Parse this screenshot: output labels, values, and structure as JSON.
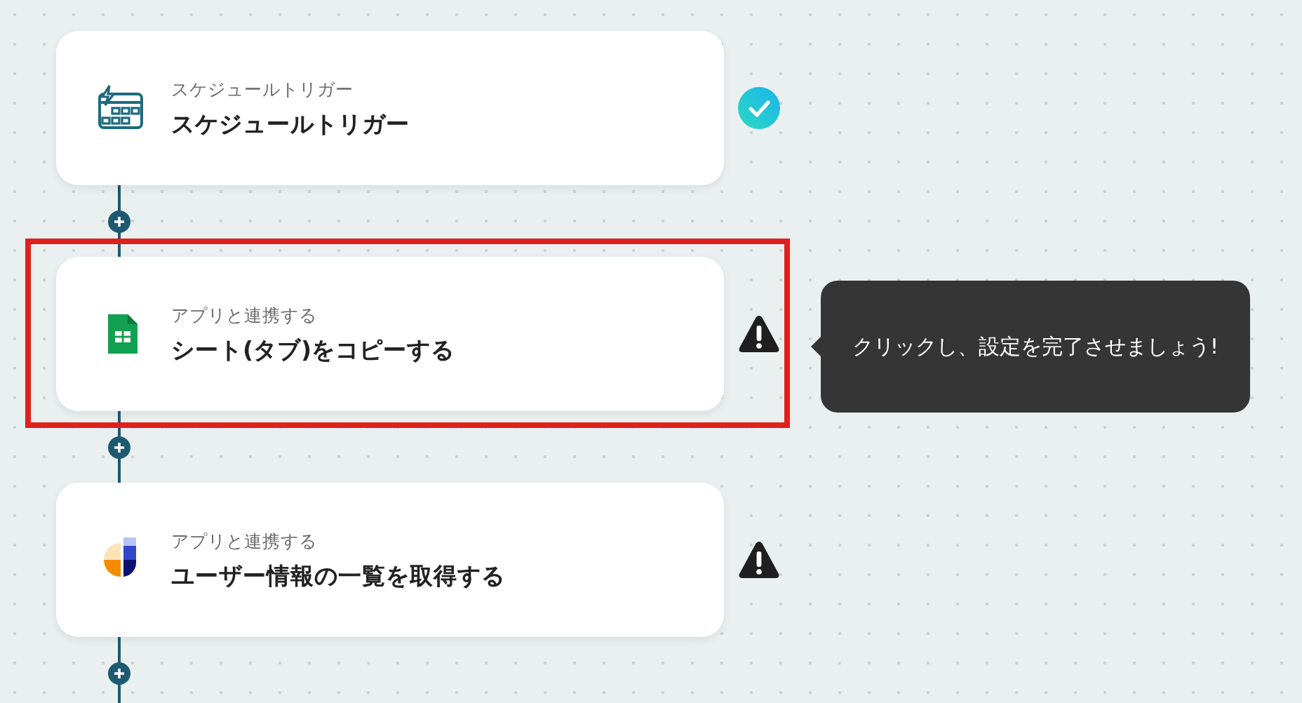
{
  "steps": [
    {
      "kind": "schedule",
      "category": "スケジュールトリガー",
      "title": "スケジュールトリガー",
      "completed": true,
      "highlighted": false
    },
    {
      "kind": "sheets",
      "category": "アプリと連携する",
      "title": "シート(タブ)をコピーする",
      "completed": false,
      "highlighted": true,
      "tooltip": "クリックし、設定を完了させましょう!"
    },
    {
      "kind": "app",
      "category": "アプリと連携する",
      "title": "ユーザー情報の一覧を取得する",
      "completed": false,
      "highlighted": false
    }
  ]
}
